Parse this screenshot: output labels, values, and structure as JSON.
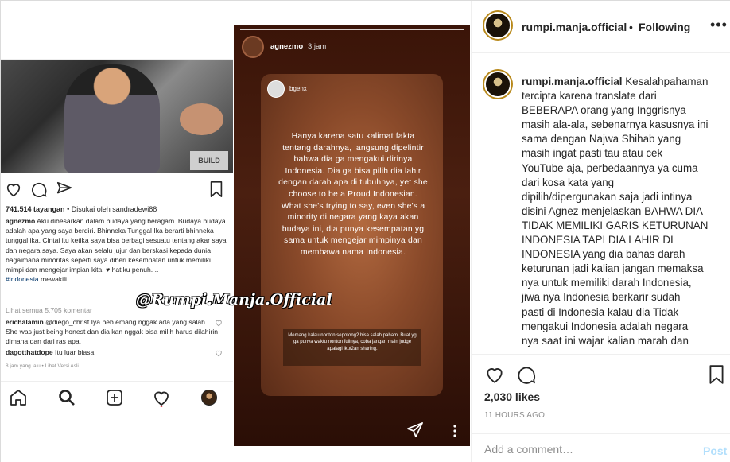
{
  "left_post": {
    "views": "741.514 tayangan",
    "liked_by": "• Disukai oleh sandradewi88",
    "username": "agnezmo",
    "caption": "Aku dibesarkan dalam budaya yang beragam. Budaya budaya adalah apa yang saya berdiri. Bhinneka Tunggal Ika berarti bhinneka tunggal ika. Cintai itu ketika saya bisa berbagi sesuatu tentang akar saya dan negara saya. Saya akan selalu jujur dan berskasi kepada dunia bagaimana minoritas seperti saya diberi kesempatan untuk memiliki mimpi dan mengejar impian kita. ♥ hatiku penuh. ..",
    "hashtag": "#indonesia",
    "hashtag_suffix": " mewakili",
    "view_all": "Lihat semua 5.705 komentar",
    "comment1_user": "erichalamin",
    "comment1_text": " @diego_christ Iya beb emang nggak ada yang salah. She was just being honest dan dia kan nggak bisa milih harus dilahirin dimana dan dari ras apa.",
    "comment2_user": "dagotthatdope",
    "comment2_text": " Itu luar biasa",
    "meta": "8 jam yang lalu • Lihat Versi Asli",
    "photo_sign": "BUILD"
  },
  "story": {
    "username": "agnezmo",
    "time": "3 jam",
    "card_user": "bgenx",
    "card_text": "Hanya karena satu kalimat fakta tentang darahnya, langsung dipelintir bahwa dia ga mengakui dirinya Indonesia. Dia ga bisa pilih dia lahir dengan darah apa di tubuhnya, yet she choose to be a Proud Indonesian. What she's trying to say, even she's a minority di negara yang kaya akan budaya ini, dia punya kesempatan yg sama untuk mengejar mimpinya dan membawa nama Indonesia.",
    "card_note": "Memang kalau nonton sepotong2 bisa salah paham. Buat yg ga punya waktu nonton fullnya, coba jangan main judge apalagi ikut2an sharing."
  },
  "watermark": "@Rumpi.Manja.Official",
  "panel": {
    "username": "rumpi.manja.official",
    "separator": "•",
    "follow_status": "Following",
    "more": "•••",
    "caption_user": "rumpi.manja.official",
    "caption_lines": [
      " Kesalahpahaman",
      "tercipta karena translate dari",
      "BEBERAPA orang yang Inggrisnya",
      "masih ala-ala, sebenarnya kasusnya ini",
      "sama dengan Najwa Shihab yang",
      "masih ingat pasti tau atau cek",
      "YouTube aja, perbedaannya ya cuma",
      "dari kosa kata yang",
      "dipilih/dipergunakan saja jadi intinya",
      "disini Agnez menjelaskan BAHWA DIA",
      "TIDAK MEMILIKI GARIS KETURUNAN",
      "INDONESIA TAPI DIA LAHIR DI",
      "INDONESIA yang dia bahas darah",
      "keturunan jadi kalian jangan memaksa",
      "nya untuk memiliki darah Indonesia,",
      "jiwa nya Indonesia berkarir sudah",
      "pasti di Indonesia kalau dia Tidak",
      "mengakui Indonesia adalah negara",
      "nya saat ini wajar kalian marah dan"
    ],
    "likes": "2,030 likes",
    "time_ago": "11 HOURS AGO",
    "comment_placeholder": "Add a comment…",
    "post_label": "Post"
  }
}
